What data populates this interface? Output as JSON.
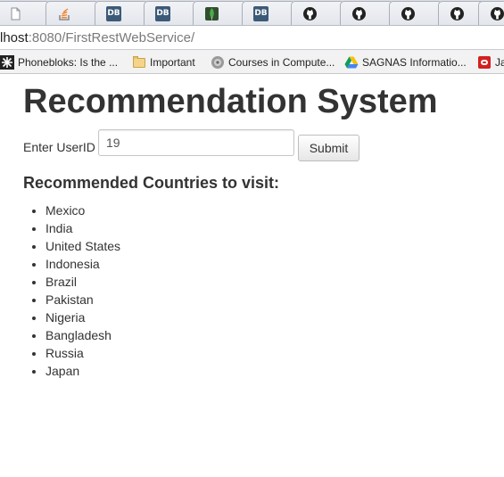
{
  "browser": {
    "tabs": [
      {
        "icon": "blank-page-icon"
      },
      {
        "icon": "stackoverflow-icon"
      },
      {
        "icon": "db-icon",
        "label": "DB"
      },
      {
        "icon": "db-icon",
        "label": "DB"
      },
      {
        "icon": "mongodb-leaf-icon"
      },
      {
        "icon": "db-icon",
        "label": "DB"
      },
      {
        "icon": "github-icon"
      },
      {
        "icon": "github-icon"
      },
      {
        "icon": "github-icon"
      },
      {
        "icon": "github-icon"
      },
      {
        "icon": "github-icon"
      }
    ],
    "address": {
      "host_visible": "lhost",
      "path": ":8080/FirstRestWebService/"
    },
    "bookmarks": [
      {
        "icon": "phonebloks-icon",
        "label": "Phonebloks: Is the ..."
      },
      {
        "icon": "folder-icon",
        "label": "Important"
      },
      {
        "icon": "courses-disc-icon",
        "label": "Courses in Compute..."
      },
      {
        "icon": "google-drive-icon",
        "label": "SAGNAS Informatio..."
      },
      {
        "icon": "oracle-icon",
        "label": "Ja"
      }
    ]
  },
  "page": {
    "title": "Recommendation System",
    "form": {
      "label": "Enter UserID",
      "value": "19",
      "submit_label": "Submit"
    },
    "results_heading": "Recommended Countries to visit:",
    "countries": [
      "Mexico",
      "India",
      "United States",
      "Indonesia",
      "Brazil",
      "Pakistan",
      "Nigeria",
      "Bangladesh",
      "Russia",
      "Japan"
    ]
  }
}
